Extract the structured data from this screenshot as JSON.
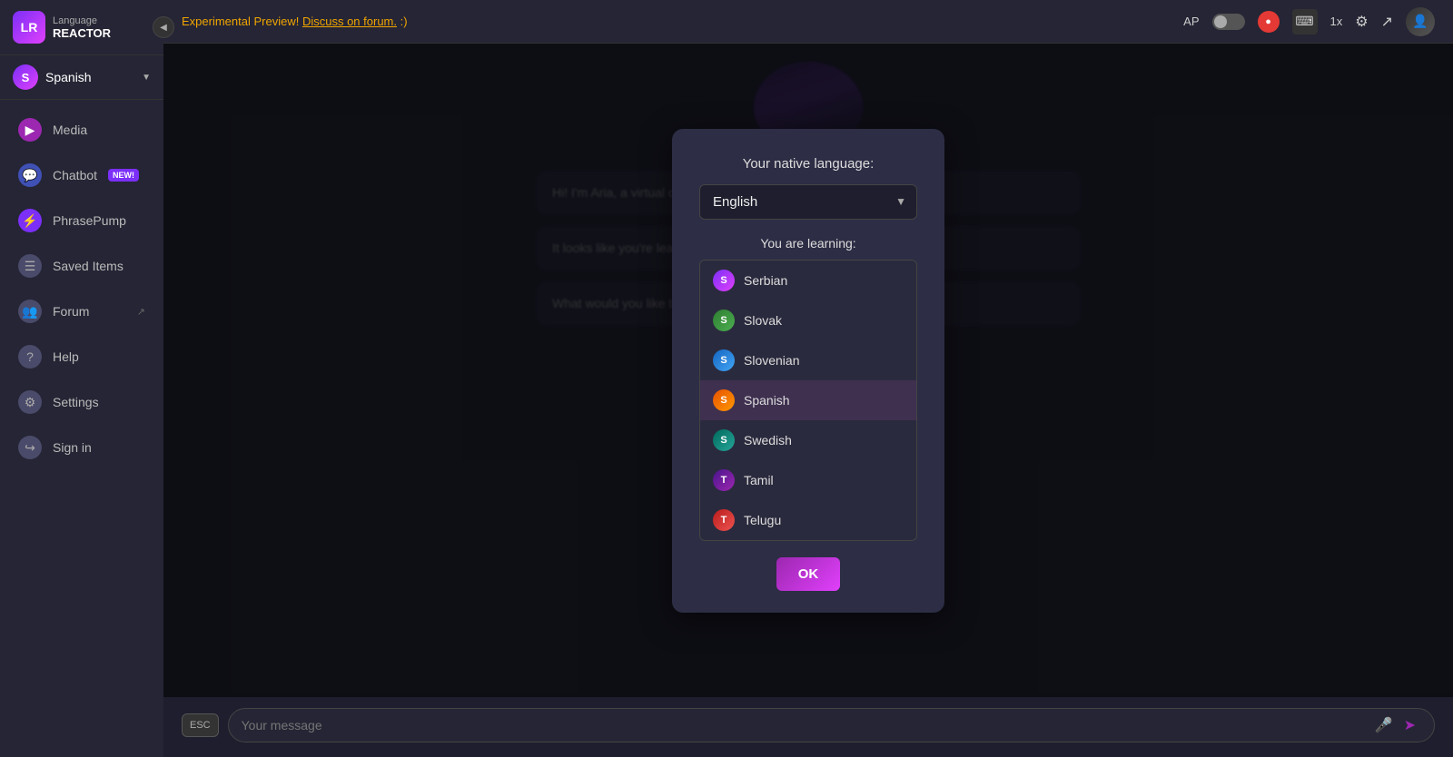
{
  "app": {
    "logo_initials": "LR",
    "logo_title": "Language",
    "logo_subtitle": "REACTOR",
    "collapse_icon": "◀"
  },
  "sidebar": {
    "language": {
      "initial": "S",
      "name": "Spanish",
      "arrow": "▼"
    },
    "nav_items": [
      {
        "id": "media",
        "label": "Media",
        "icon": "▶",
        "icon_class": "nav-icon-media"
      },
      {
        "id": "chatbot",
        "label": "Chatbot",
        "icon": "💬",
        "icon_class": "nav-icon-chatbot",
        "badge": "NEW!"
      },
      {
        "id": "phrasepump",
        "label": "PhrasePump",
        "icon": "⚡",
        "icon_class": "nav-icon-phrasepump"
      },
      {
        "id": "saved",
        "label": "Saved Items",
        "icon": "☰",
        "icon_class": "nav-icon-saved"
      },
      {
        "id": "forum",
        "label": "Forum",
        "icon": "👥",
        "icon_class": "nav-icon-forum",
        "external": true
      },
      {
        "id": "help",
        "label": "Help",
        "icon": "?",
        "icon_class": "nav-icon-help"
      },
      {
        "id": "settings",
        "label": "Settings",
        "icon": "⚙",
        "icon_class": "nav-icon-settings"
      },
      {
        "id": "signin",
        "label": "Sign in",
        "icon": "↪",
        "icon_class": "nav-icon-signin"
      }
    ]
  },
  "topbar": {
    "experimental_text": "Experimental Preview! Discuss on forum. :)",
    "ap_label": "AP",
    "speed_label": "1x"
  },
  "dialog": {
    "native_language_label": "Your native language:",
    "selected_native": "English",
    "dropdown_arrow": "▼",
    "learning_label": "You are learning:",
    "dropdown_items": [
      {
        "id": "serbian",
        "initial": "S",
        "label": "Serbian",
        "color": "purple"
      },
      {
        "id": "slovak",
        "initial": "S",
        "label": "Slovak",
        "color": "green"
      },
      {
        "id": "slovenian",
        "initial": "S",
        "label": "Slovenian",
        "color": "blue"
      },
      {
        "id": "spanish",
        "initial": "S",
        "label": "Spanish",
        "color": "orange",
        "selected": true
      },
      {
        "id": "swedish",
        "initial": "S",
        "label": "Swedish",
        "color": "teal"
      },
      {
        "id": "tamil",
        "initial": "T",
        "label": "Tamil",
        "color": "dark-purple"
      },
      {
        "id": "telugu",
        "initial": "T",
        "label": "Telugu",
        "color": "red"
      }
    ],
    "ok_label": "OK"
  },
  "chat": {
    "messages": [
      {
        "text": "Hi! I'm Aria, a virtual conversation partner."
      },
      {
        "text": "It looks like you're learning in Spanish, but you can write it in English."
      },
      {
        "text": "What would you like to talk about?"
      }
    ]
  },
  "message_input": {
    "placeholder": "Your message",
    "esc_label": "ESC"
  }
}
